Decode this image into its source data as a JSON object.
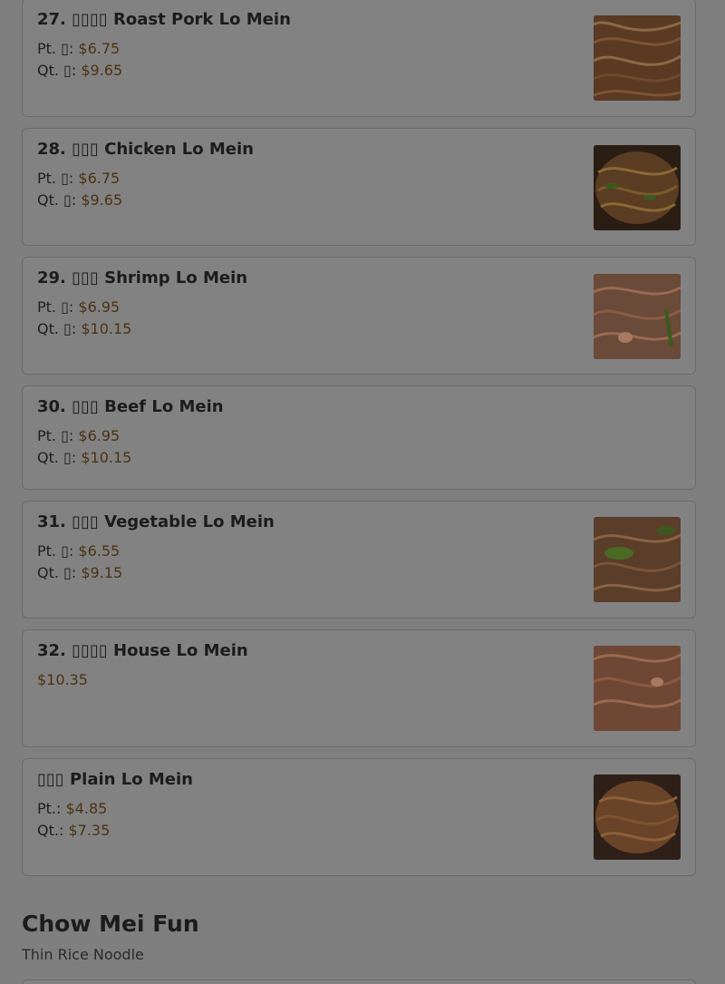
{
  "items": [
    {
      "title": "27. ▯▯▯▯ Roast Pork Lo Mein",
      "line1_label": "Pt. ▯:",
      "line1_value": "$6.75",
      "line2_label": "Qt. ▯:",
      "line2_value": "$9.65"
    },
    {
      "title": "28. ▯▯▯ Chicken Lo Mein",
      "line1_label": "Pt. ▯:",
      "line1_value": "$6.75",
      "line2_label": "Qt. ▯:",
      "line2_value": "$9.65"
    },
    {
      "title": "29. ▯▯▯ Shrimp Lo Mein",
      "line1_label": "Pt. ▯:",
      "line1_value": "$6.95",
      "line2_label": "Qt. ▯:",
      "line2_value": "$10.15"
    },
    {
      "title": "30. ▯▯▯ Beef Lo Mein",
      "line1_label": "Pt. ▯:",
      "line1_value": "$6.95",
      "line2_label": "Qt. ▯:",
      "line2_value": "$10.15"
    },
    {
      "title": "31. ▯▯▯ Vegetable Lo Mein",
      "line1_label": "Pt. ▯:",
      "line1_value": "$6.55",
      "line2_label": "Qt. ▯:",
      "line2_value": "$9.15"
    },
    {
      "title": "32. ▯▯▯▯ House Lo Mein",
      "line1_value": "$10.35"
    },
    {
      "title": "▯▯▯ Plain Lo Mein",
      "line1_label": "Pt.:",
      "line1_value": "$4.85",
      "line2_label": "Qt.:",
      "line2_value": "$7.35"
    }
  ],
  "section": {
    "title": "Chow Mei Fun",
    "subtitle": "Thin Rice Noodle"
  },
  "colors": {
    "overlay_background": "#7f7f7f",
    "price": "#4a3413"
  },
  "icons": {
    "dish_photo": "noodle-dish-photo"
  }
}
